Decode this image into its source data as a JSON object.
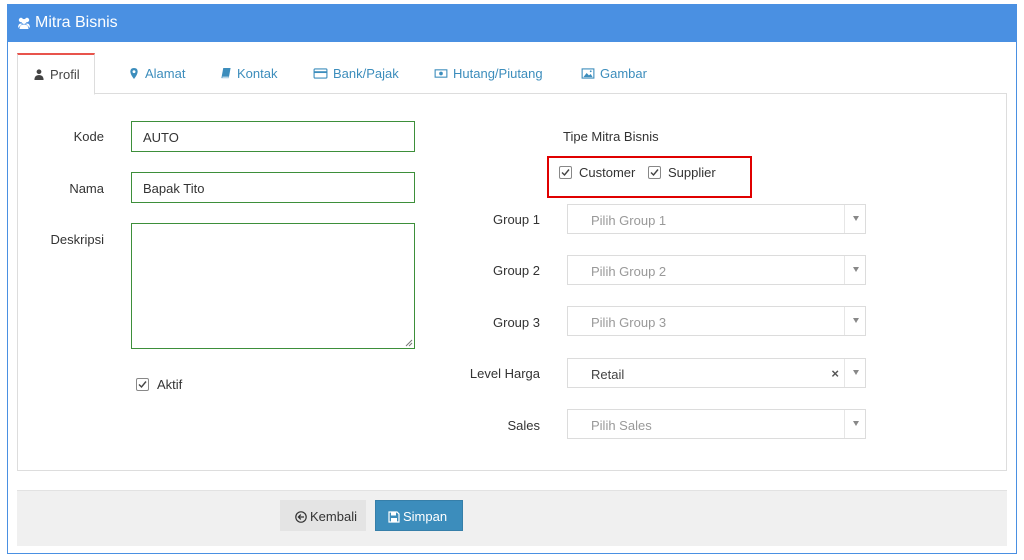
{
  "window": {
    "title": "Mitra Bisnis",
    "icon": "users-icon"
  },
  "tabs": [
    {
      "label": "Profil",
      "icon": "user-icon",
      "active": true
    },
    {
      "label": "Alamat",
      "icon": "map-marker-icon"
    },
    {
      "label": "Kontak",
      "icon": "book-icon"
    },
    {
      "label": "Bank/Pajak",
      "icon": "credit-card-icon"
    },
    {
      "label": "Hutang/Piutang",
      "icon": "money-icon"
    },
    {
      "label": "Gambar",
      "icon": "image-icon"
    }
  ],
  "form": {
    "kode": {
      "label": "Kode",
      "value": "AUTO"
    },
    "nama": {
      "label": "Nama",
      "value": "Bapak Tito"
    },
    "deskripsi": {
      "label": "Deskripsi",
      "value": ""
    },
    "aktif": {
      "label": "Aktif",
      "checked": true
    },
    "tipe": {
      "label": "Tipe Mitra Bisnis",
      "customer": {
        "label": "Customer",
        "checked": true
      },
      "supplier": {
        "label": "Supplier",
        "checked": true
      }
    },
    "group1": {
      "label": "Group 1",
      "placeholder": "Pilih Group 1"
    },
    "group2": {
      "label": "Group 2",
      "placeholder": "Pilih Group 2"
    },
    "group3": {
      "label": "Group 3",
      "placeholder": "Pilih Group 3"
    },
    "level_harga": {
      "label": "Level Harga",
      "value": "Retail",
      "clear": "×"
    },
    "sales": {
      "label": "Sales",
      "placeholder": "Pilih Sales"
    }
  },
  "footer": {
    "back_label": "Kembali",
    "save_label": "Simpan"
  },
  "colors": {
    "header": "#4a90e2",
    "active_tab_accent": "#e8544c",
    "input_border": "#3d8f3a",
    "highlight": "#e00000",
    "save_button": "#3c8dbc"
  }
}
